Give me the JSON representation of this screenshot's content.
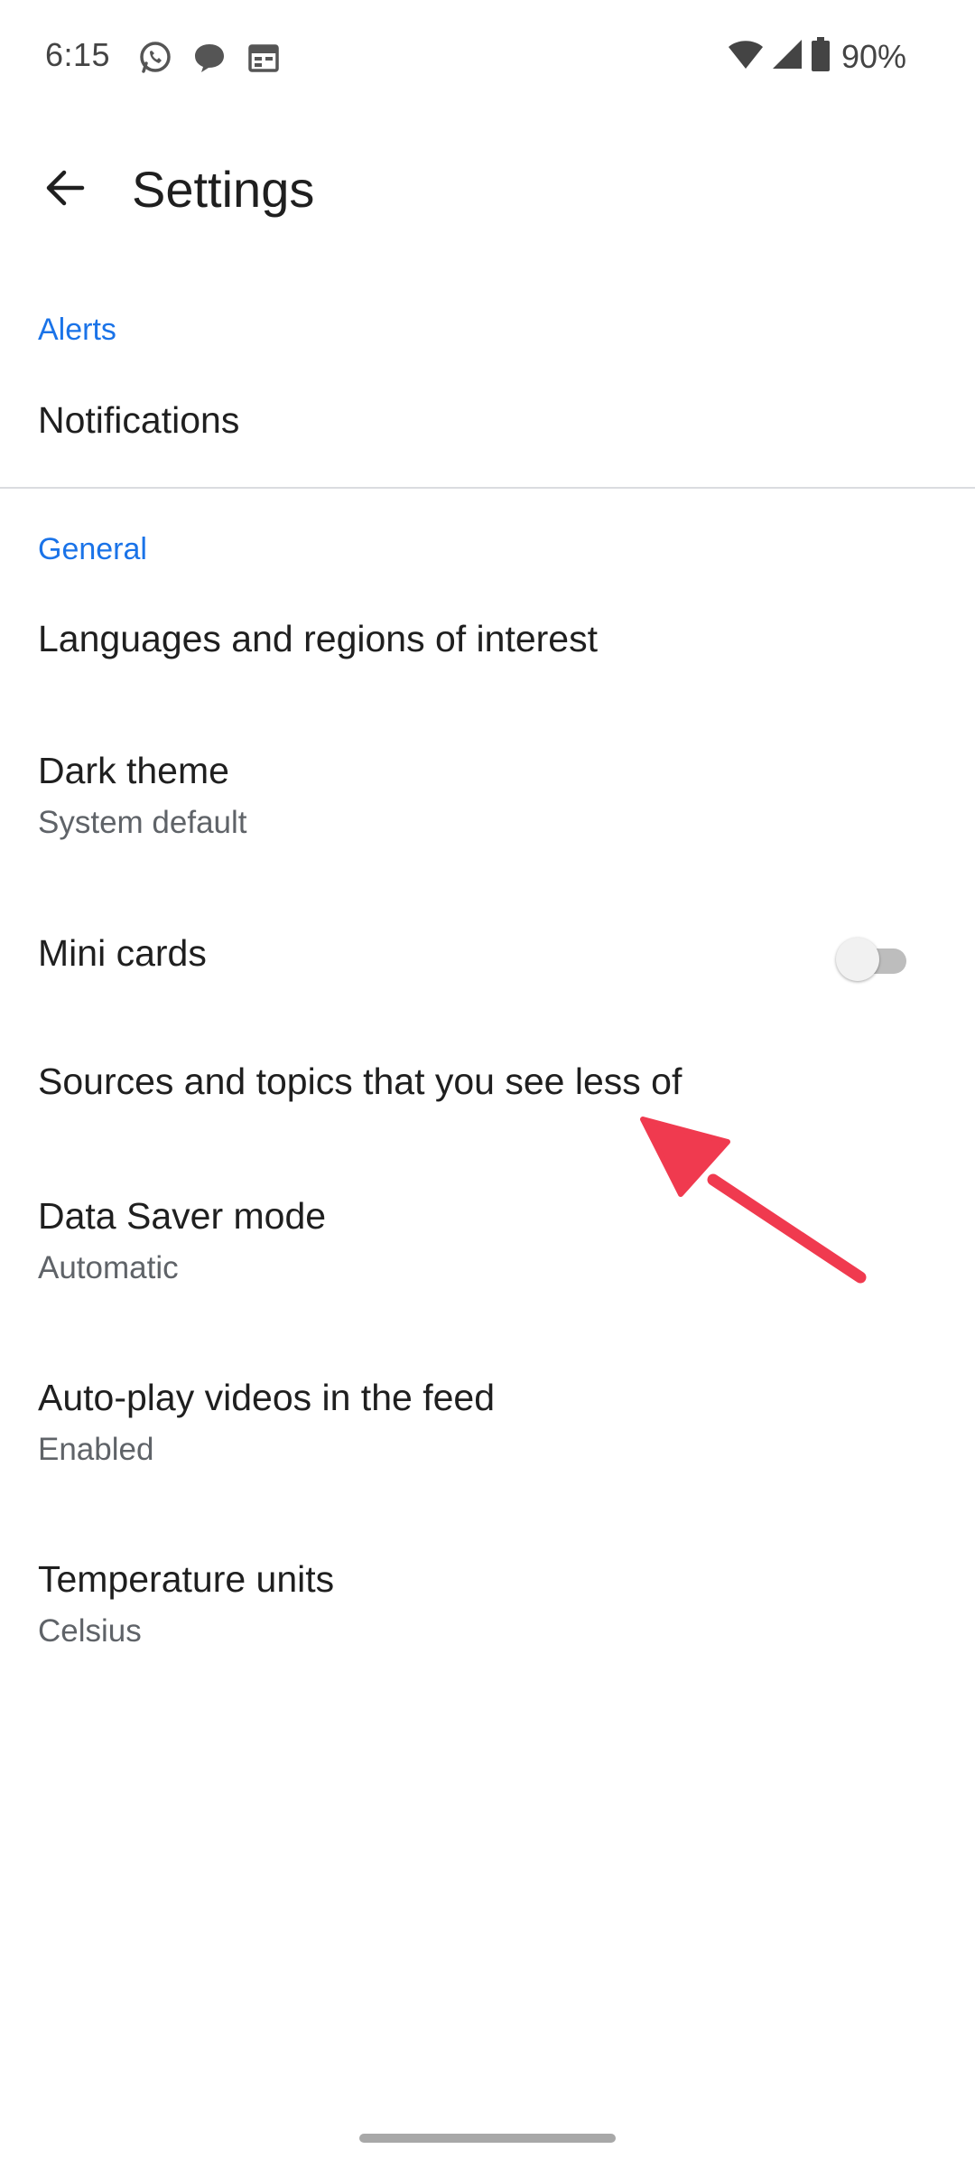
{
  "status_bar": {
    "time": "6:15",
    "battery_percent": "90%",
    "left_icons": [
      "whatsapp-icon",
      "chat-bubble-icon",
      "calendar-icon"
    ],
    "right_icons": [
      "wifi-icon",
      "cell-signal-icon",
      "battery-icon"
    ]
  },
  "app_bar": {
    "title": "Settings",
    "back_icon": "arrow-back-icon"
  },
  "sections": {
    "alerts": {
      "header": "Alerts",
      "items": {
        "notifications": {
          "title": "Notifications"
        }
      }
    },
    "general": {
      "header": "General",
      "items": {
        "languages": {
          "title": "Languages and regions of interest"
        },
        "dark_theme": {
          "title": "Dark theme",
          "subtitle": "System default"
        },
        "mini_cards": {
          "title": "Mini cards",
          "toggle_on": false
        },
        "sources_topics": {
          "title": "Sources and topics that you see less of"
        },
        "data_saver": {
          "title": "Data Saver mode",
          "subtitle": "Automatic"
        },
        "autoplay": {
          "title": "Auto-play videos in the feed",
          "subtitle": "Enabled"
        },
        "temperature": {
          "title": "Temperature units",
          "subtitle": "Celsius"
        }
      }
    }
  },
  "colors": {
    "accent": "#1a73e8",
    "annotation_arrow": "#f03a4f",
    "text_primary": "#1f1f1f",
    "text_secondary": "#5f6368"
  }
}
